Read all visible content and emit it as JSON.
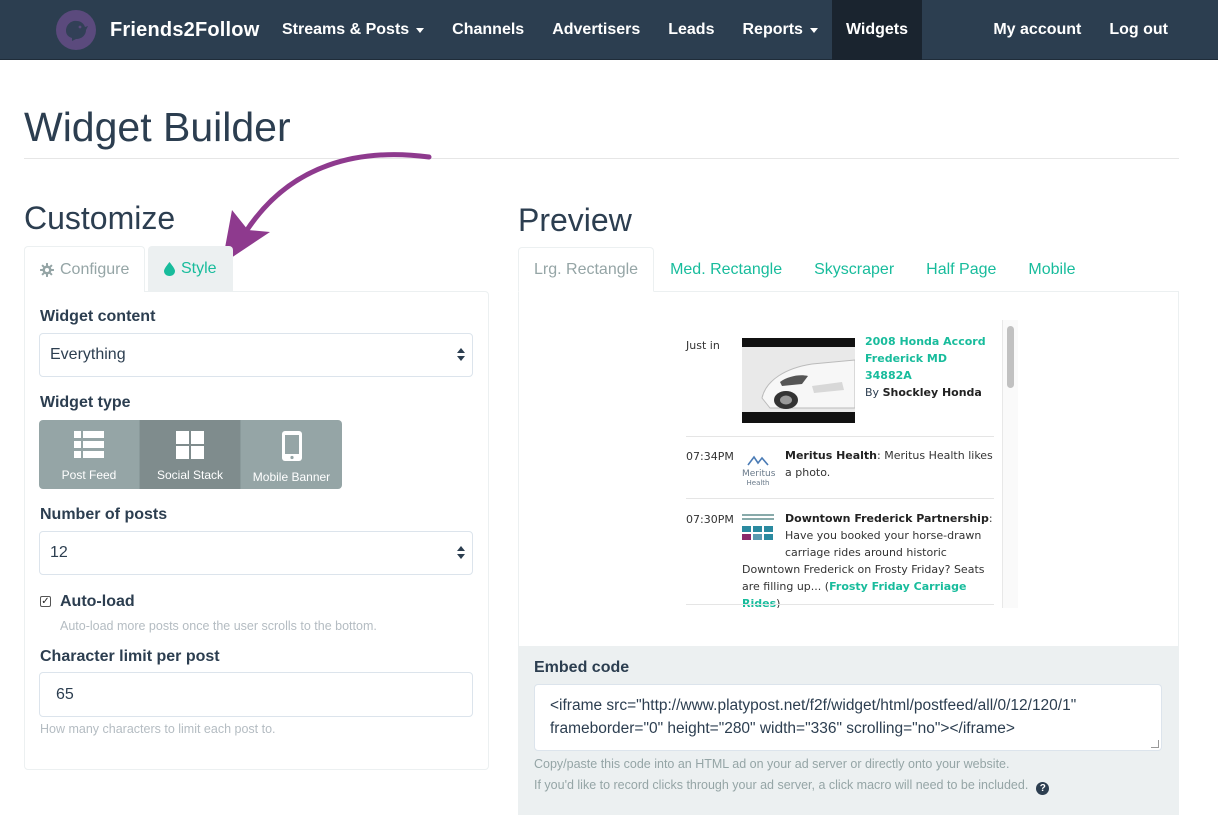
{
  "navbar": {
    "brand": "Friends2Follow",
    "items": [
      {
        "label": "Streams & Posts",
        "dropdown": true,
        "active": false
      },
      {
        "label": "Channels",
        "dropdown": false,
        "active": false
      },
      {
        "label": "Advertisers",
        "dropdown": false,
        "active": false
      },
      {
        "label": "Leads",
        "dropdown": false,
        "active": false
      },
      {
        "label": "Reports",
        "dropdown": true,
        "active": false
      },
      {
        "label": "Widgets",
        "dropdown": false,
        "active": true
      }
    ],
    "right_items": [
      {
        "label": "My account"
      },
      {
        "label": "Log out"
      }
    ]
  },
  "page": {
    "title": "Widget Builder"
  },
  "customize": {
    "title": "Customize",
    "tabs": [
      {
        "label": "Configure",
        "icon": "gear-icon"
      },
      {
        "label": "Style",
        "icon": "droplet-icon"
      }
    ],
    "widget_content": {
      "label": "Widget content",
      "value": "Everything"
    },
    "widget_type": {
      "label": "Widget type",
      "options": [
        {
          "label": "Post Feed",
          "icon": "list-icon"
        },
        {
          "label": "Social Stack",
          "icon": "grid-icon"
        },
        {
          "label": "Mobile Banner",
          "icon": "mobile-icon"
        }
      ],
      "selected": "Social Stack"
    },
    "number_of_posts": {
      "label": "Number of posts",
      "value": "12"
    },
    "auto_load": {
      "label": "Auto-load",
      "checked": true,
      "help": "Auto-load more posts once the user scrolls to the bottom."
    },
    "char_limit": {
      "label": "Character limit per post",
      "value": "65",
      "help": "How many characters to limit each post to."
    }
  },
  "preview": {
    "title": "Preview",
    "tabs": [
      {
        "label": "Lrg. Rectangle",
        "active": true
      },
      {
        "label": "Med. Rectangle",
        "active": false
      },
      {
        "label": "Skyscraper",
        "active": false
      },
      {
        "label": "Half Page",
        "active": false
      },
      {
        "label": "Mobile",
        "active": false
      }
    ],
    "posts": [
      {
        "time": "Just in",
        "title_line1": "2008 Honda Accord",
        "title_line2": "Frederick MD 34882A",
        "by": "By",
        "author": "Shockley Honda"
      },
      {
        "time": "07:34PM",
        "avatar_text1": "Meritus",
        "avatar_text2": "Health",
        "author": "Meritus Health",
        "text": ": Meritus Health likes a photo."
      },
      {
        "time": "07:30PM",
        "author": "Downtown Frederick Partnership",
        "text_line1": "Have you booked your horse-drawn",
        "text_line2": "carriage rides around historic",
        "text_line3": "Downtown Frederick on Frosty Friday? Seats",
        "text_line4_pre": "are filling up... (",
        "link": "Frosty Friday Carriage Rides",
        "text_line4_post": ")"
      }
    ]
  },
  "embed": {
    "label": "Embed code",
    "code_line1": "<iframe src=\"http://www.platypost.net/f2f/widget/html/postfeed/all/0/12/120/1\"",
    "code_line2": "frameborder=\"0\" height=\"280\" width=\"336\" scrolling=\"no\"></iframe>",
    "help1": "Copy/paste this code into an HTML ad on your ad server or directly onto your website.",
    "help2": "If you'd like to record clicks through your ad server, a click macro will need to be included."
  },
  "colors": {
    "navbar": "#2c3e50",
    "accent": "#18bc9c",
    "arrow": "#8e3a8e",
    "button_gray": "#95a5a6"
  }
}
